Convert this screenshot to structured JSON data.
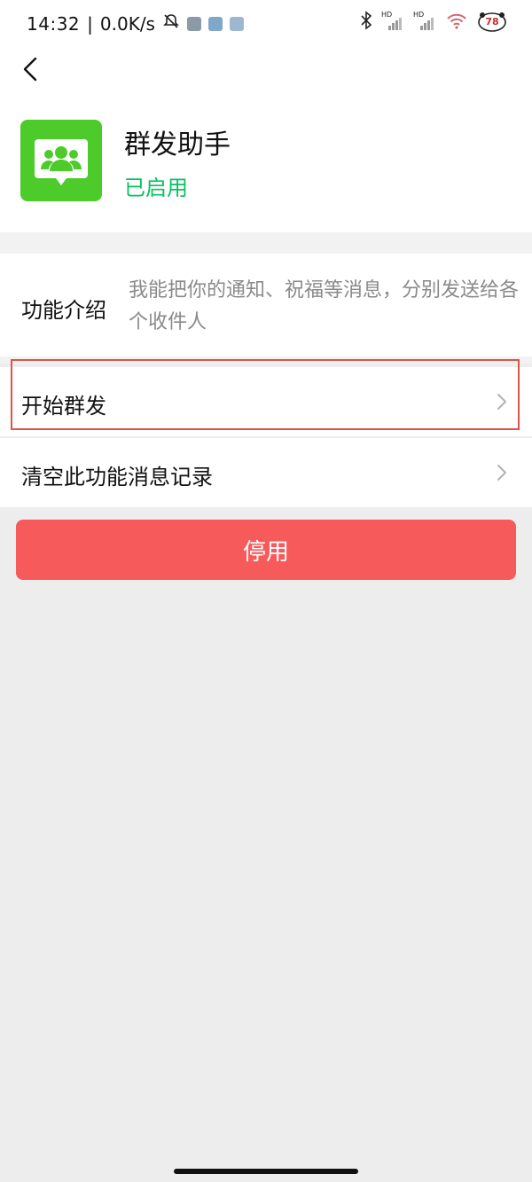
{
  "status_bar": {
    "time": "14:32",
    "separator": "|",
    "network_speed": "0.0K/s",
    "hd1": "HD",
    "hd2": "HD",
    "battery": "78"
  },
  "app": {
    "name": "群发助手",
    "status": "已启用"
  },
  "intro": {
    "label": "功能介绍",
    "text": "我能把你的通知、祝福等消息，分别发送给各个收件人"
  },
  "rows": [
    {
      "label": "开始群发"
    },
    {
      "label": "清空此功能消息记录"
    }
  ],
  "disable_button": "停用",
  "colors": {
    "app_icon_green": "#4CCB2A",
    "enabled_green": "#07C160",
    "disable_red": "#F75A5A",
    "highlight_red": "#E0524A"
  }
}
